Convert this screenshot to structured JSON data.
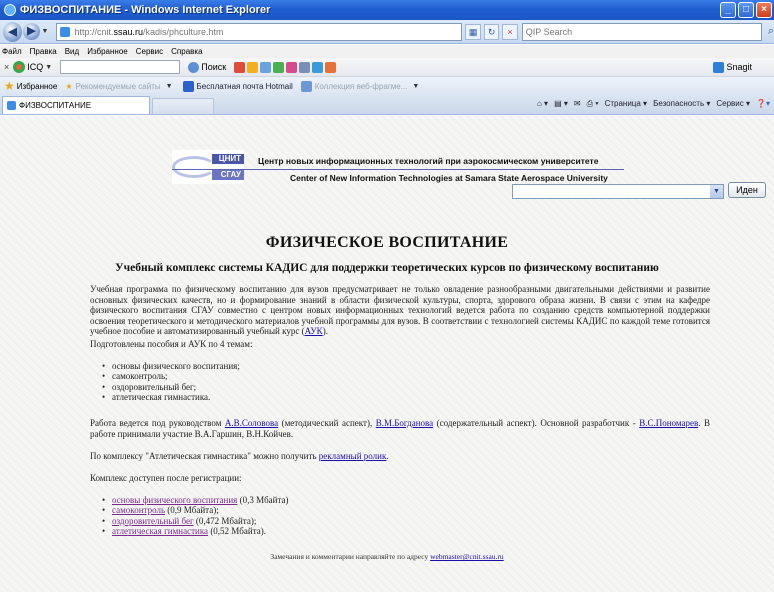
{
  "window": {
    "title": "ФИЗВОСПИТАНИЕ - Windows Internet Explorer"
  },
  "address_bar": {
    "url_prefix": "http://cnit.",
    "url_host": "ssau.ru",
    "url_path": "/kadis/phculture.htm",
    "search_placeholder": "QIP Search"
  },
  "menu": [
    "Файл",
    "Правка",
    "Вид",
    "Избранное",
    "Сервис",
    "Справка"
  ],
  "toolbar": {
    "icq_label": "ICQ",
    "search_label": "Поиск",
    "snagit_label": "Snagit"
  },
  "favorites_bar": {
    "favorites_label": "Избранное",
    "items": [
      "Рекомендуемые сайты",
      "Бесплатная почта Hotmail",
      "Коллекция веб-фрагме..."
    ]
  },
  "tab": {
    "label": "ФИЗВОСПИТАНИЕ",
    "tools": [
      "Страница",
      "Безопасность",
      "Сервис"
    ]
  },
  "header": {
    "logo_top": "ЦНИТ",
    "logo_bottom": "СГАУ",
    "title_ru": "Центр новых информационных технологий при аэрокосмическом университете",
    "title_en": "Center of New Information Technologies at Samara State Aerospace University",
    "go_button": "Иден"
  },
  "page": {
    "title": "ФИЗИЧЕСКОЕ ВОСПИТАНИЕ",
    "subtitle": "Учебный комплекс системы КАДИС для поддержки теоретических курсов по физическому воспитанию",
    "intro_text": "Учебная программа по физическому воспитанию для вузов предусматривает не только овладение разнообразными двигательными действиями и развитие основных физических качеств, но и формирование знаний в области физической культуры, спорта, здорового образа жизни. В связи с этим на кафедре физического воспитания СГАУ совместно с центром новых информационных технологий ведется работа по созданию средств компьютерной поддержки освоения теоретического и методического материалов учебной программы для вузов. В соответствии с технологией системы КАДИС по каждой теме готовится учебное пособие и автоматизированный учебный курс (",
    "intro_link": "АУК",
    "intro_end": ").",
    "topics_heading": "Подготовлены пособия и АУК по 4 темам:",
    "topics": [
      "основы физического воспитания;",
      "самоконтроль;",
      "оздоровительный бег;",
      "атлетическая гимнастика."
    ],
    "work_text_1": "Работа ведется под руководством ",
    "work_link_1": "А.В.Соловова",
    "work_text_2": " (методический аспект), ",
    "work_link_2": "В.М.Богданова",
    "work_text_3": " (содержательный аспект). Основной разработчик - ",
    "work_link_3": "В.С.Пономарев",
    "work_text_4": ". В работе принимали участие В.А.Гаршин, В.Н.Койчев.",
    "promo_text": "По комплексу \"Атлетическая гимнастика\" можно получить ",
    "promo_link": "рекламный ролик",
    "promo_end": ".",
    "access_text": "Комплекс доступен после регистрации:",
    "downloads": [
      {
        "link": "основы физического воспитания",
        "size": " (0,3 Мбайта)"
      },
      {
        "link": "самоконтроль",
        "size": " (0,9 Мбайта);"
      },
      {
        "link": "оздоровительный бег",
        "size": " (0,472 Мбайта);"
      },
      {
        "link": "атлетическая гимнастика",
        "size": " (0,52 Мбайта)."
      }
    ],
    "footer_text": "Замечания и комментарии направляйте по адресу ",
    "footer_email": "webmaster@cnit.ssau.ru"
  }
}
